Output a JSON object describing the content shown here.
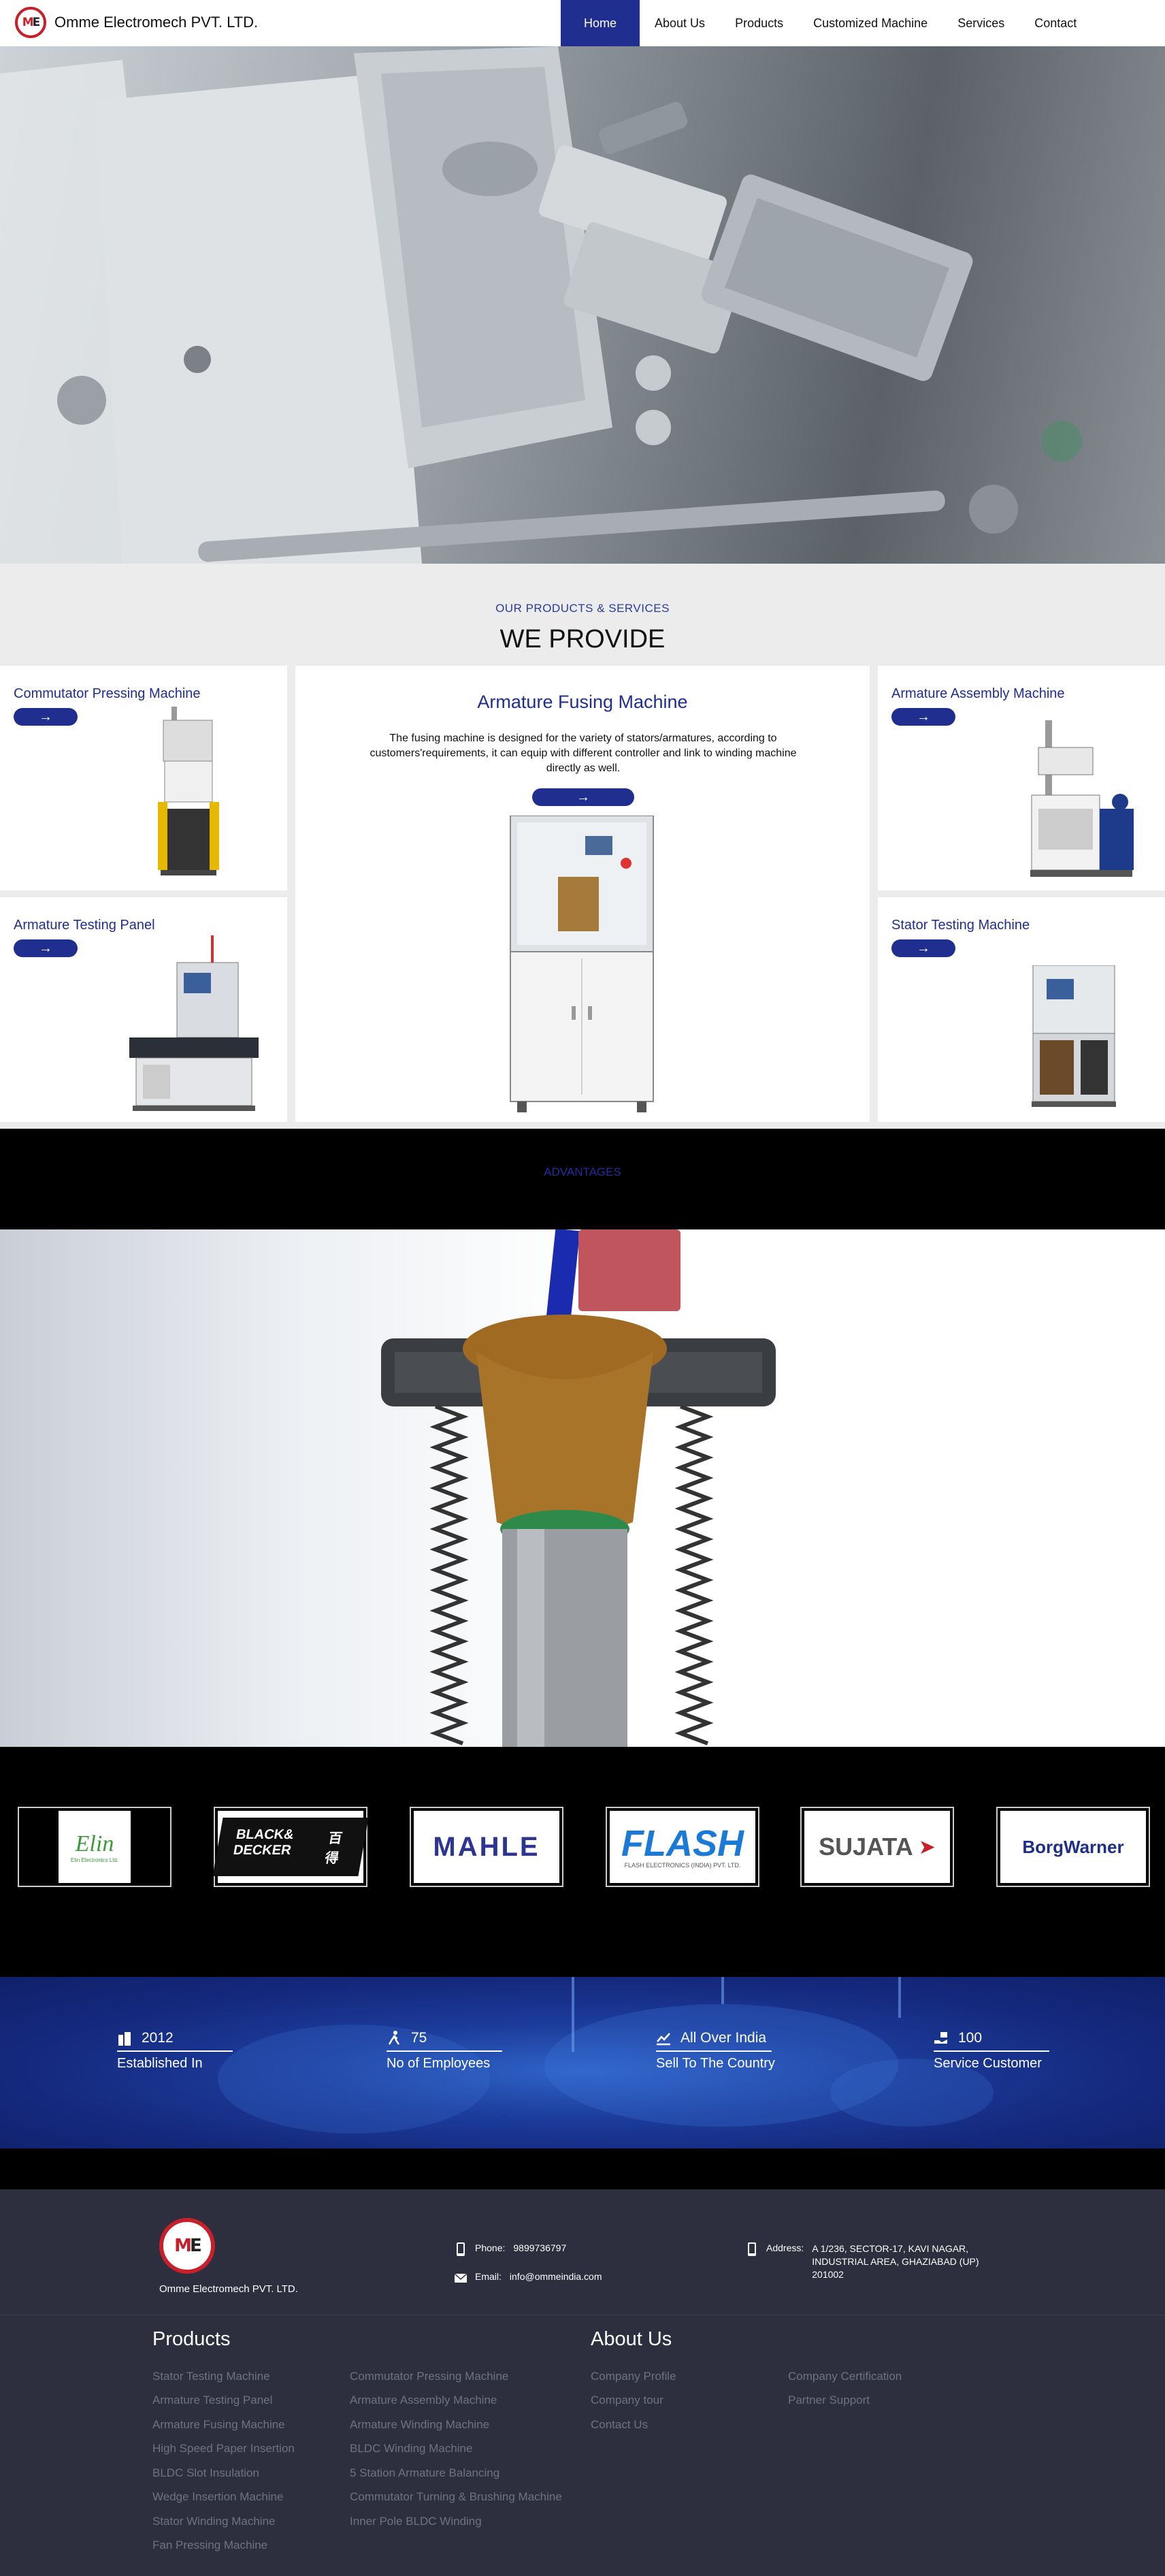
{
  "nav": {
    "logo_text_m": "M",
    "logo_text_e": "E",
    "brand_name": "Omme Electromech PVT. LTD.",
    "items": [
      {
        "label": "Home",
        "active": true
      },
      {
        "label": "About Us"
      },
      {
        "label": "Products"
      },
      {
        "label": "Customized Machine"
      },
      {
        "label": "Services"
      },
      {
        "label": "Contact"
      }
    ]
  },
  "provide": {
    "subtitle": "OUR PRODUCTS & SERVICES",
    "title": "WE PROVIDE",
    "arrow": "→",
    "cards": {
      "commutator": "Commutator Pressing Machine",
      "armature_testing": "Armature Testing Panel",
      "center_title": "Armature Fusing Machine",
      "center_desc": "The fusing machine is designed for the variety of stators/armatures, according to customers'requirements, it can equip with different controller and link to winding machine directly as well.",
      "armature_assembly": "Armature Assembly Machine",
      "stator_testing": "Stator Testing Machine"
    }
  },
  "advantages": {
    "label": "ADVANTAGES"
  },
  "clients": {
    "logos": [
      "Elin Electronics Ltd.",
      "BLACK&DECKER",
      "MAHLE",
      "FLASH",
      "SUJATA",
      "BorgWarner"
    ],
    "elin_name": "Elin",
    "elin_sub": "Elin Electronics Ltd.",
    "bd_name": "BLACK& DECKER",
    "bd_cn": "百得",
    "mahle": "MAHLE",
    "flash": "FLASH",
    "flash_sub": "FLASH ELECTRONICS (INDIA) PVT. LTD.",
    "sujata": "SUJATA",
    "borg": "BorgWarner"
  },
  "stats": [
    {
      "value": "2012",
      "label": "Established In",
      "icon": "building-icon"
    },
    {
      "value": "75",
      "label": "No of Employees",
      "icon": "person-running-icon"
    },
    {
      "value": "All Over India",
      "label": "Sell To The Country",
      "icon": "chart-line-icon"
    },
    {
      "value": "100",
      "label": "Service Customer",
      "icon": "hand-holding-icon"
    }
  ],
  "footer": {
    "company": "Omme Electromech PVT. LTD.",
    "phone_label": "Phone:",
    "phone": "9899736797",
    "email_label": "Email:",
    "email": "info@ommeindia.com",
    "address_label": "Address:",
    "address": "A 1/236, SECTOR-17, KAVI NAGAR, INDUSTRIAL AREA, GHAZIABAD (UP) 201002",
    "products_heading": "Products",
    "about_heading": "About Us",
    "products_col1": [
      "Stator Testing Machine",
      "Armature Testing Panel",
      "Armature Fusing Machine",
      "High Speed Paper Insertion",
      "BLDC Slot Insulation",
      "Wedge Insertion Machine",
      "Stator Winding Machine",
      "Fan Pressing Machine"
    ],
    "products_col2": [
      "Commutator Pressing Machine",
      "Armature Assembly Machine",
      "Armature Winding Machine",
      "BLDC Winding Machine",
      "5 Station Armature Balancing",
      "Commutator Turning & Brushing Machine",
      "Inner Pole BLDC Winding"
    ],
    "about_col1": [
      "Company Profile",
      "Company tour",
      "Contact Us"
    ],
    "about_col2": [
      "Company Certification",
      "Partner Support"
    ]
  }
}
